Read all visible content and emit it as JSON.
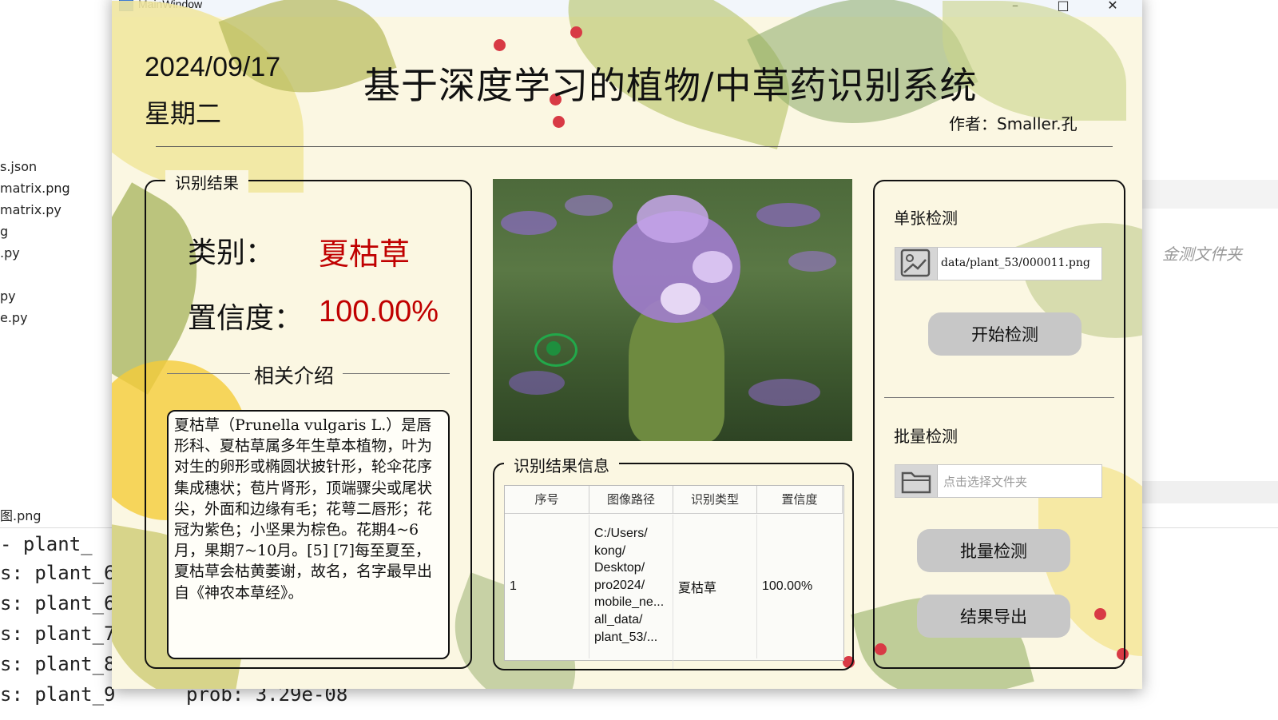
{
  "background_ide": {
    "files": [
      "s.json",
      "matrix.png",
      "matrix.py",
      "g",
      ".py",
      "py",
      "e.py",
      "图.png"
    ],
    "console_lines": [
      "s: plant_6",
      "s: plant_6",
      "s: plant_7",
      "s: plant_8",
      "s: plant_9"
    ],
    "console_partial_top": "- plant_",
    "console_prob": "prob: 3.29e-08",
    "right_text": "金测文件夹"
  },
  "window": {
    "title": "MainWindow",
    "minimize": "–",
    "maximize": "□",
    "close": "✕"
  },
  "header": {
    "date": "2024/09/17",
    "weekday": "星期二",
    "title": "基于深度学习的植物/中草药识别系统",
    "author": "作者：Smaller.孔"
  },
  "result": {
    "group_title": "识别结果",
    "class_label": "类别：",
    "class_value": "夏枯草",
    "confidence_label": "置信度：",
    "confidence_value": "100.00%",
    "intro_heading": "相关介绍",
    "intro_text": "夏枯草（Prunella vulgaris L.）是唇形科、夏枯草属多年生草本植物，叶为对生的卵形或椭圆状披针形，轮伞花序集成穗状；苞片肾形，顶端骤尖或尾状尖，外面和边缘有毛；花萼二唇形；花冠为紫色；小坚果为棕色。花期4~6月，果期7~10月。[5] [7]每至夏至，夏枯草会枯黄萎谢，故名，名字最早出自《神农本草经》。"
  },
  "image": {
    "description_icon": "detected-plant-image"
  },
  "info": {
    "group_title": "识别结果信息",
    "columns": [
      "序号",
      "图像路径",
      "识别类型",
      "置信度"
    ],
    "rows": [
      {
        "index": "1",
        "path": "C:/Users/\nkong/\nDesktop/\npro2024/\nmobile_ne...\nall_data/\nplant_53/...",
        "type": "夏枯草",
        "confidence": "100.00%"
      }
    ]
  },
  "controls": {
    "single_label": "单张检测",
    "single_path": "data/plant_53/000011.png",
    "start_button": "开始检测",
    "batch_label": "批量检测",
    "batch_placeholder": "点击选择文件夹",
    "batch_button": "批量检测",
    "export_button": "结果导出"
  },
  "colors": {
    "accent_red": "#c00000",
    "background": "#fbf7e2",
    "button": "#c7c7c7"
  }
}
